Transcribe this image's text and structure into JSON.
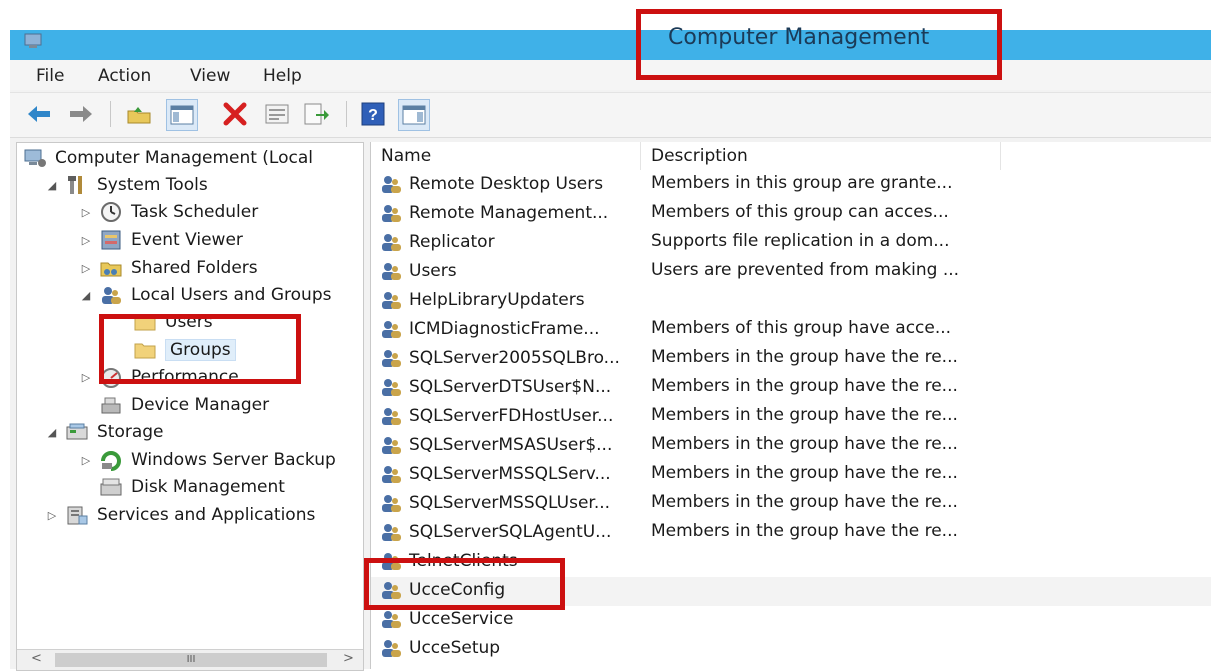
{
  "window": {
    "title": "Computer Management"
  },
  "menu": [
    "File",
    "Action",
    "View",
    "Help"
  ],
  "toolbar": [
    {
      "icon": "back-arrow-icon"
    },
    {
      "icon": "forward-arrow-icon"
    },
    {
      "icon": "up-folder-icon"
    },
    {
      "icon": "show-hide-tree-icon"
    },
    {
      "icon": "delete-icon"
    },
    {
      "icon": "properties-icon"
    },
    {
      "icon": "export-list-icon"
    },
    {
      "icon": "help-icon"
    },
    {
      "icon": "show-action-pane-icon"
    }
  ],
  "tree": [
    {
      "label": "Computer Management (Local",
      "expander": "",
      "icon": "computer-icon"
    },
    {
      "label": "System Tools",
      "expander": "◢",
      "icon": "tools-icon"
    },
    {
      "label": "Task Scheduler",
      "expander": "▷",
      "icon": "clock-icon"
    },
    {
      "label": "Event Viewer",
      "expander": "▷",
      "icon": "event-viewer-icon"
    },
    {
      "label": "Shared Folders",
      "expander": "▷",
      "icon": "shared-folder-icon"
    },
    {
      "label": "Local Users and Groups",
      "expander": "◢",
      "icon": "users-icon"
    },
    {
      "label": "Users",
      "expander": "",
      "icon": "folder-icon"
    },
    {
      "label": "Groups",
      "expander": "",
      "icon": "folder-icon"
    },
    {
      "label": "Performance",
      "expander": "▷",
      "icon": "performance-icon"
    },
    {
      "label": "Device Manager",
      "expander": "",
      "icon": "device-manager-icon"
    },
    {
      "label": "Storage",
      "expander": "◢",
      "icon": "storage-icon"
    },
    {
      "label": "Windows Server Backup",
      "expander": "▷",
      "icon": "backup-icon"
    },
    {
      "label": "Disk Management",
      "expander": "",
      "icon": "disk-icon"
    },
    {
      "label": "Services and Applications",
      "expander": "▷",
      "icon": "services-icon"
    }
  ],
  "scrollbar": {
    "left_arrow": "<",
    "thumb": "III",
    "right_arrow": ">"
  },
  "list": {
    "columns": [
      "Name",
      "Description"
    ],
    "rows": [
      {
        "name": "Remote Desktop Users",
        "desc": "Members in this group are grante..."
      },
      {
        "name": "Remote Management...",
        "desc": "Members of this group can acces..."
      },
      {
        "name": "Replicator",
        "desc": "Supports file replication in a dom..."
      },
      {
        "name": "Users",
        "desc": "Users are prevented from making ..."
      },
      {
        "name": "HelpLibraryUpdaters",
        "desc": ""
      },
      {
        "name": "ICMDiagnosticFrame...",
        "desc": "Members of this group have acce..."
      },
      {
        "name": "SQLServer2005SQLBro...",
        "desc": "Members in the group have the re..."
      },
      {
        "name": "SQLServerDTSUser$N...",
        "desc": "Members in the group have the re..."
      },
      {
        "name": "SQLServerFDHostUser...",
        "desc": "Members in the group have the re..."
      },
      {
        "name": "SQLServerMSASUser$...",
        "desc": "Members in the group have the re..."
      },
      {
        "name": "SQLServerMSSQLServ...",
        "desc": "Members in the group have the re..."
      },
      {
        "name": "SQLServerMSSQLUser...",
        "desc": "Members in the group have the re..."
      },
      {
        "name": "SQLServerSQLAgentU...",
        "desc": "Members in the group have the re..."
      },
      {
        "name": "TelnetClients",
        "desc": ""
      },
      {
        "name": "UcceConfig",
        "desc": ""
      },
      {
        "name": "UcceService",
        "desc": ""
      },
      {
        "name": "UcceSetup",
        "desc": ""
      }
    ]
  },
  "colors": {
    "titlebar": "#3fb1e8",
    "highlight_box": "#cc1010",
    "selection": "#e0eefa"
  }
}
